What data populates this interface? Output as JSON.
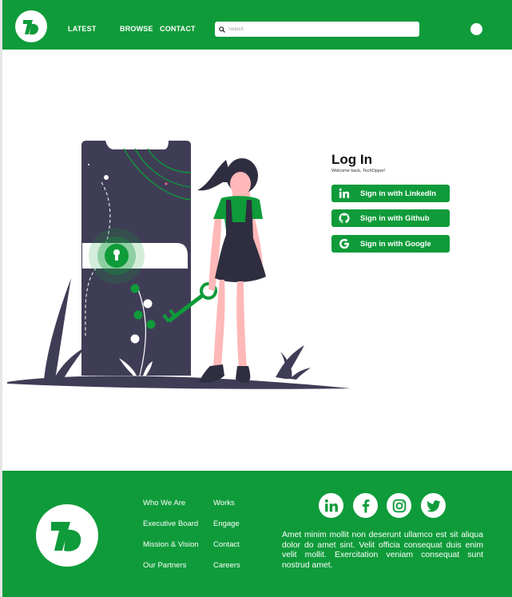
{
  "colors": {
    "brand": "#0f9b3a",
    "dark": "#3f3d56",
    "skin": "#ffb8b8"
  },
  "header": {
    "logo_icon": "techopper-logo-icon",
    "nav": {
      "latest": "LATEST",
      "browse": "BROWSE",
      "contact": "CONTACT"
    },
    "search": {
      "placeholder": "Search",
      "icon": "search-icon"
    },
    "avatar_icon": "user-avatar"
  },
  "login": {
    "title": "Log In",
    "subtitle": "Welcome back, TechOpper!",
    "buttons": [
      {
        "label": "Sign in with LinkedIn",
        "icon": "linkedin-icon"
      },
      {
        "label": "Sign in with Github",
        "icon": "github-icon"
      },
      {
        "label": "Sign in with Google",
        "icon": "google-icon"
      }
    ]
  },
  "footer": {
    "logo_icon": "techopper-logo-icon",
    "col1": [
      "Who We Are",
      "Executive Board",
      "Mission & Vision",
      "Our Partners"
    ],
    "col2": [
      "Works",
      "Engage",
      "Contact",
      "Careers"
    ],
    "social": [
      "linkedin-icon",
      "facebook-icon",
      "instagram-icon",
      "twitter-icon"
    ],
    "text": "Amet minim mollit non deserunt ullamco est sit aliqua dolor do amet sint. Velit officia consequat duis enim velit mollit. Exercitation veniam consequat sunt nostrud amet."
  }
}
